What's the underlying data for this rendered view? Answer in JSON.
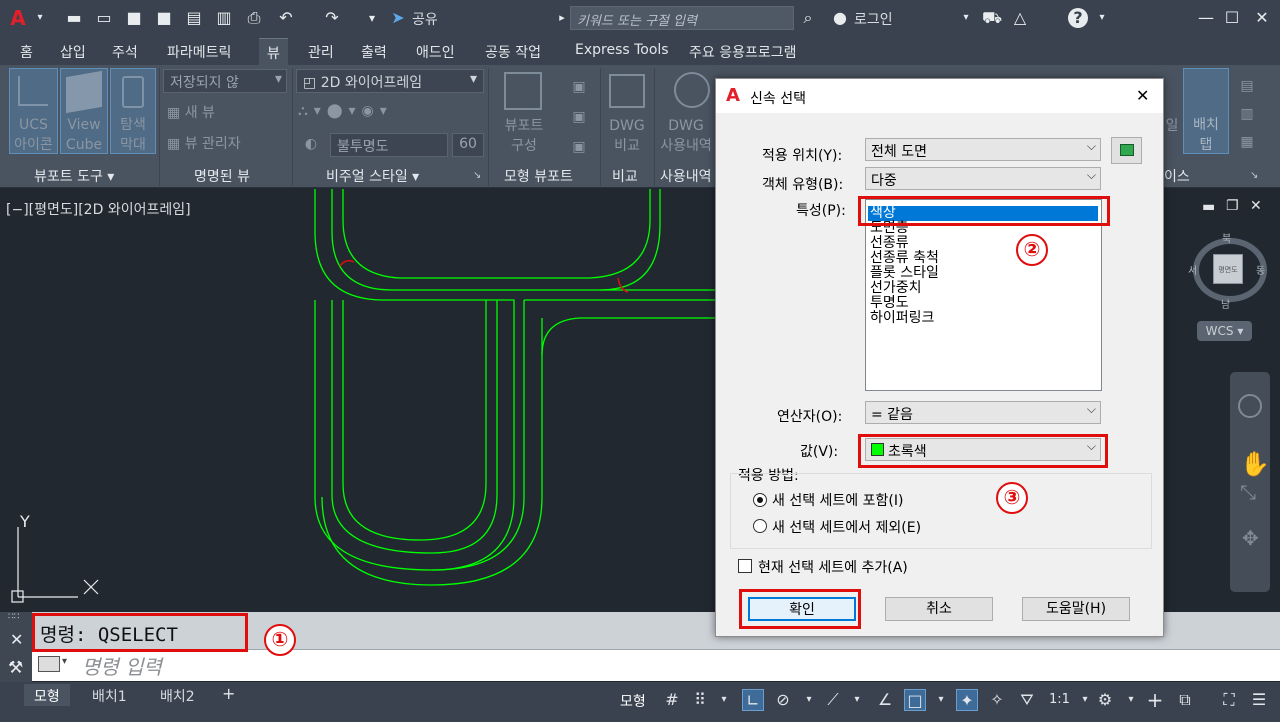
{
  "app": {
    "search_placeholder": "키워드 또는 구절 입력",
    "share_label": "공유",
    "login_label": "로그인"
  },
  "ribbon_tabs": [
    "홈",
    "삽입",
    "주석",
    "파라메트릭",
    "뷰",
    "관리",
    "출력",
    "애드인",
    "공동 작업",
    "Express Tools",
    "주요 응용프로그램"
  ],
  "ribbon": {
    "ucs_label": "UCS\n아이콘",
    "viewcube_label": "View\nCube",
    "navbar_label": "탐색\n막대",
    "unsaved_view": "저장되지 않",
    "new_view": "새 뷰",
    "view_manager": "뷰 관리자",
    "visual_style": "2D 와이어프레임",
    "opacity_label": "불투명도",
    "opacity_value": "60",
    "viewport_config": "뷰포트\n구성",
    "dwg_compare": "DWG\n비교",
    "dwg_history": "DWG\n사용내역",
    "layout_tab": "배치\n탭",
    "layout_partial": "일",
    "panels": {
      "viewport_tools": "뷰포트 도구",
      "named_views": "명명된 뷰",
      "visual_styles": "비주얼 스타일",
      "model_viewports": "모형 뷰포트",
      "compare": "비교",
      "history": "사용내역",
      "interface": "이스"
    }
  },
  "viewport": {
    "label": "[−][평면도][2D 와이어프레임]",
    "compass": {
      "n": "북",
      "s": "남",
      "w": "서",
      "e": "동",
      "cube_label": "평면도"
    },
    "wcs": "WCS",
    "ucs_y": "Y",
    "ucs_x": "X"
  },
  "command": {
    "history_text": "명령: QSELECT",
    "input_placeholder": "명령 입력",
    "close_icon": "✕"
  },
  "layout_tabs": [
    "모형",
    "배치1",
    "배치2"
  ],
  "status": {
    "model_label": "모형",
    "scale": "1:1"
  },
  "dialog": {
    "title": "신속 선택",
    "apply_to_label": "적용 위치(Y):",
    "apply_to_value": "전체 도면",
    "object_type_label": "객체 유형(B):",
    "object_type_value": "다중",
    "properties_label": "특성(P):",
    "properties": [
      "색상",
      "도면층",
      "선종류",
      "선종류 축척",
      "플롯 스타일",
      "선가중치",
      "투명도",
      "하이퍼링크"
    ],
    "operator_label": "연산자(O):",
    "operator_value": "= 같음",
    "value_label": "값(V):",
    "value_value": "초록색",
    "value_color": "#00ff00",
    "how_to_apply": "적용 방법:",
    "radio_include": "새 선택 세트에 포함(I)",
    "radio_exclude": "새 선택 세트에서 제외(E)",
    "append_label": "현재 선택 세트에 추가(A)",
    "ok": "확인",
    "cancel": "취소",
    "help": "도움말(H)"
  },
  "annotations": {
    "one": "①",
    "two": "②",
    "three": "③"
  },
  "colors": {
    "highlight": "#e00d0d",
    "linework": "#00ff00",
    "accent": "#0078d7"
  }
}
